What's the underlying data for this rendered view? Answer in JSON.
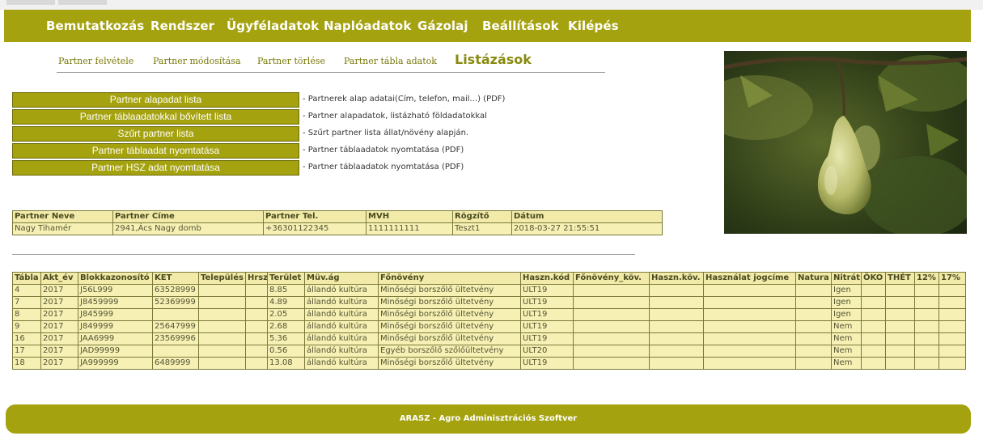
{
  "top_menu": {
    "items": [
      "Bemutatkozás",
      "Rendszer",
      "Ügyféladatok",
      "Naplóadatok",
      "Gázolaj",
      "Beállítások",
      "Kilépés"
    ]
  },
  "sub_menu": {
    "items": [
      "Partner felvétele",
      "Partner módosítása",
      "Partner törlése",
      "Partner tábla adatok"
    ],
    "active": "Listázások"
  },
  "reports": [
    {
      "label": "Partner alapadat lista",
      "desc": "- Partnerek alap adatai(Cím, telefon, mail...) (PDF)"
    },
    {
      "label": "Partner táblaadatokkal bővített lista",
      "desc": "- Partner alapadatok, listázható földadatokkal"
    },
    {
      "label": "Szűrt partner lista",
      "desc": "- Szűrt partner lista állat/növény alapján."
    },
    {
      "label": "Partner táblaadat nyomtatása",
      "desc": "- Partner táblaadatok nyomtatása (PDF)"
    },
    {
      "label": "Partner HSZ adat nyomtatása",
      "desc": "- Partner táblaadatok nyomtatása (PDF)"
    }
  ],
  "partner_table": {
    "headers": [
      "Partner Neve",
      "Partner Címe",
      "Partner Tel.",
      "MVH",
      "Rögzítő",
      "Dátum"
    ],
    "row": [
      "Nagy Tihamér",
      "2941,Ács Nagy domb",
      "+36301122345",
      "1111111111",
      "Teszt1",
      "2018-03-27 21:55:51"
    ]
  },
  "block_table": {
    "headers": [
      "Tábla",
      "Akt_év",
      "Blokkazonosító",
      "KET",
      "Település",
      "Hrsz",
      "Terület",
      "Müv.ág",
      "Főnövény",
      "Haszn.kód",
      "Főnövény_köv.",
      "Haszn.köv.",
      "Használat jogcíme",
      "Natura",
      "Nitrát",
      "ÖKO",
      "THÉT",
      "12%",
      "17%"
    ],
    "rows": [
      [
        "4",
        "2017",
        "J56L999",
        "63528999",
        "",
        "",
        "8.85",
        "állandó kultúra",
        "Minőségi borszőlő ültetvény",
        "ULT19",
        "",
        "",
        "",
        "",
        "Igen",
        "",
        "",
        "",
        ""
      ],
      [
        "7",
        "2017",
        "J8459999",
        "52369999",
        "",
        "",
        "4.89",
        "állandó kultúra",
        "Minőségi borszőlő ültetvény",
        "ULT19",
        "",
        "",
        "",
        "",
        "Igen",
        "",
        "",
        "",
        ""
      ],
      [
        "8",
        "2017",
        "J845999",
        "",
        "",
        "",
        "2.05",
        "állandó kultúra",
        "Minőségi borszőlő ültetvény",
        "ULT19",
        "",
        "",
        "",
        "",
        "Igen",
        "",
        "",
        "",
        ""
      ],
      [
        "9",
        "2017",
        "J849999",
        "25647999",
        "",
        "",
        "2.68",
        "állandó kultúra",
        "Minőségi borszőlő ültetvény",
        "ULT19",
        "",
        "",
        "",
        "",
        "Nem",
        "",
        "",
        "",
        ""
      ],
      [
        "16",
        "2017",
        "JAA6999",
        "23569996",
        "",
        "",
        "5.36",
        "állandó kultúra",
        "Minőségi borszőlő ültetvény",
        "ULT19",
        "",
        "",
        "",
        "",
        "Nem",
        "",
        "",
        "",
        ""
      ],
      [
        "17",
        "2017",
        "JAD99999",
        "",
        "",
        "",
        "0.56",
        "állandó kultúra",
        "Egyéb borszőlő szőlőültetvény",
        "ULT20",
        "",
        "",
        "",
        "",
        "Nem",
        "",
        "",
        "",
        ""
      ],
      [
        "18",
        "2017",
        "JA999999",
        "6489999",
        "",
        "",
        "13.08",
        "állandó kultúra",
        "Minőségi borszőlő ültetvény",
        "ULT19",
        "",
        "",
        "",
        "",
        "Nem",
        "",
        "",
        "",
        ""
      ]
    ]
  },
  "footer": {
    "text": "ARASZ - Agro Adminisztrációs Szoftver"
  },
  "colors": {
    "brand": "#a5a20f",
    "table_bg": "#f6f0b4",
    "header_bg": "#f1eaa8"
  },
  "image": {
    "icon": "pear-tree-photo"
  }
}
